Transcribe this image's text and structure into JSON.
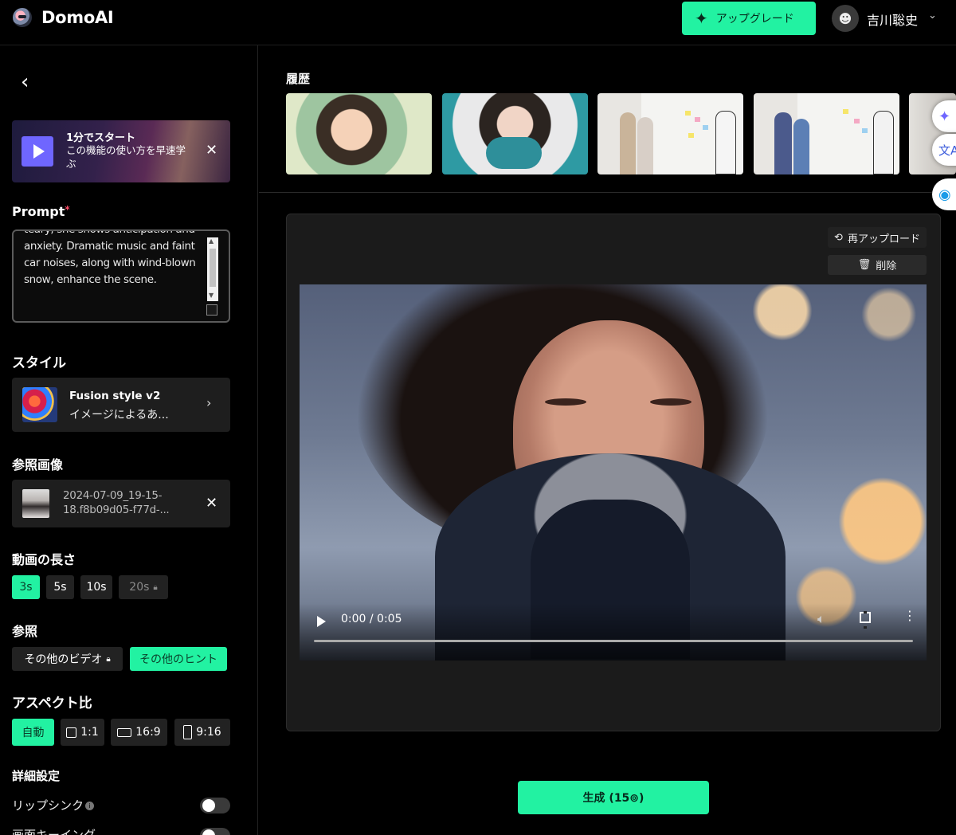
{
  "header": {
    "brand": "DomoAI",
    "upgrade_label": "アップグレード",
    "username": "吉川聡史"
  },
  "sidebar": {
    "quickstart": {
      "title": "1分でスタート",
      "desc": "この機能の使い方を早速学ぶ"
    },
    "prompt": {
      "label": "Prompt",
      "required_mark": "*",
      "text": "teary, she shows anticipation and anxiety. Dramatic music and faint car noises, along with wind-blown snow, enhance the scene."
    },
    "style": {
      "label": "スタイル",
      "name": "Fusion style v2",
      "desc": "イメージによるあ..."
    },
    "reference_image": {
      "label": "参照画像",
      "filename": "2024-07-09_19-15-18.f8b09d05-f77d-..."
    },
    "duration": {
      "label": "動画の長さ",
      "options": [
        "3s",
        "5s",
        "10s",
        "20s"
      ],
      "selected": "3s"
    },
    "reference": {
      "label": "参照",
      "options": [
        "その他のビデオ",
        "その他のヒント"
      ],
      "selected": "その他のヒント"
    },
    "aspect": {
      "label": "アスペクト比",
      "options": [
        "自動",
        "1:1",
        "16:9",
        "9:16"
      ],
      "selected": "自動"
    },
    "details": {
      "label": "詳細設定",
      "lipsync_label": "リップシンク",
      "next_label": "画面キーイング"
    }
  },
  "main": {
    "history_label": "履歴",
    "reupload_label": "再アップロード",
    "delete_label": "削除",
    "video_time": "0:00 / 0:05",
    "generate_label": "生成 (15⊚)"
  },
  "colors": {
    "accent": "#22f2a2",
    "quickstart_play": "#6f66ff"
  }
}
